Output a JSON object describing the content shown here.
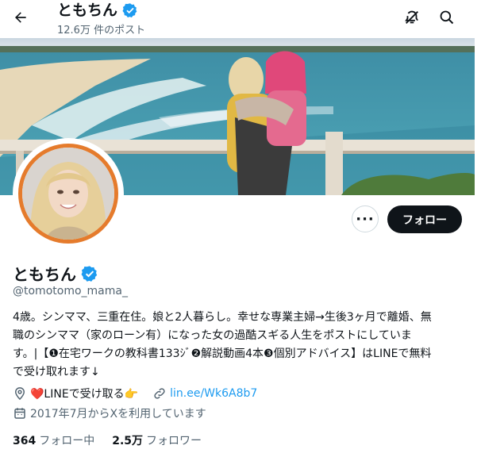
{
  "header": {
    "name": "ともちん",
    "post_count": "12.6万 件のポスト"
  },
  "profile": {
    "name": "ともちん",
    "handle": "@tomotomo_mama_",
    "bio_lines": [
      "4歳。シンママ、三重在住。娘と2人暮らし。幸せな専業主婦→生後3ヶ月で離婚、無",
      "職のシンママ（家のローン有）になった女の過酷スギる人生をポストにしていま",
      "す。|【❶在宅ワークの教科書133ｼﾞ❷解説動画4本❸個別アドバイス】はLINEで無料",
      "で受け取れます↓"
    ],
    "location": "❤️LINEで受け取る👉",
    "website": "lin.ee/Wk6A8b7",
    "joined": "2017年7月からXを利用しています"
  },
  "actions": {
    "more": "···",
    "follow": "フォロー"
  },
  "stats": {
    "following_count": "364",
    "following_label": "フォロー中",
    "followers_count": "2.5万",
    "followers_label": "フォロワー"
  },
  "colors": {
    "accent": "#1d9bf0",
    "verified": "#1d9bf0",
    "avatar_ring": "#e57b2c",
    "follow_button": "#0f1419",
    "secondary_text": "#536471"
  },
  "icons": {
    "back": "arrow-left-icon",
    "notify": "bell-slash-icon",
    "search": "search-icon",
    "location": "location-pin-icon",
    "link": "link-icon",
    "calendar": "calendar-icon",
    "verified": "verified-badge-icon"
  }
}
